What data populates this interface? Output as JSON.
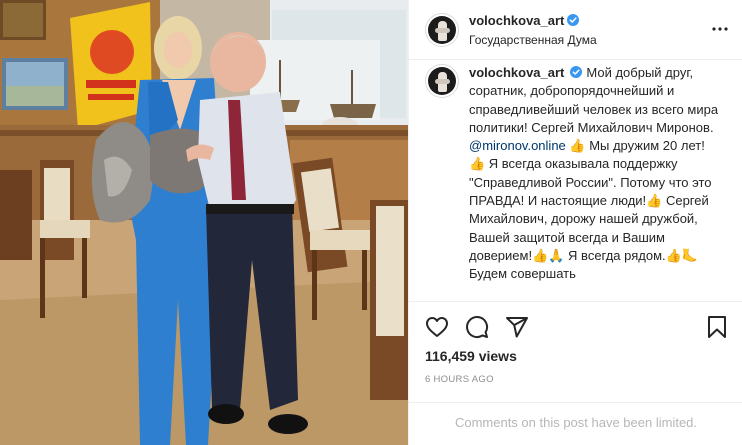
{
  "post": {
    "author": {
      "username": "volochkova_art",
      "verified": true,
      "avatar_icon": "avatar-photo-icon",
      "location": "Государственная Дума"
    },
    "caption": {
      "username": "volochkova_art",
      "text_before_mention": "Мой добрый друг, соратник, добропорядочнейший и справедливейший человек из всего мира политики! Сергей Михайлович Миронов. ",
      "mention": "@mironov.online",
      "text_after_mention": " 👍 Мы дружим 20 лет!👍 Я всегда оказывала поддержку \"Справедливой России\". Потому что это ПРАВДА! И настоящие люди!👍 Сергей Михайлович, дорожу нашей дружбой, Вашей защитой всегда и Вашим доверием!👍🙏 Я всегда рядом.👍🦶 Будем совершать"
    },
    "views": "116,459 views",
    "timestamp": "6 HOURS AGO",
    "comments_notice": "Comments on this post have been limited."
  },
  "icons": {
    "more": "more-options-icon",
    "like": "heart-icon",
    "comment": "comment-icon",
    "share": "share-icon",
    "save": "bookmark-icon",
    "verified": "verified-badge-icon"
  },
  "colors": {
    "text": "#262626",
    "secondary": "#8e8e8e",
    "mention": "#00376b",
    "verified": "#3897f0",
    "divider": "#efefef"
  }
}
